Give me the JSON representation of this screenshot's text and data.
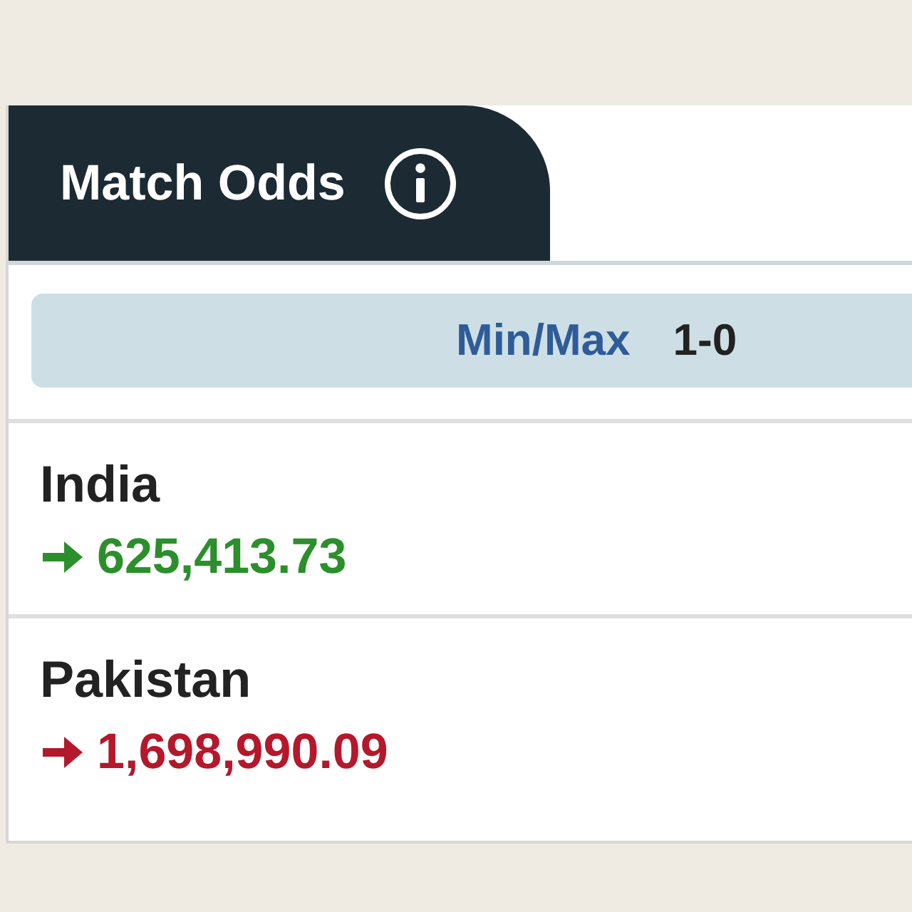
{
  "tab": {
    "title": "Match Odds"
  },
  "limits": {
    "label": "Min/Max",
    "value": "1-0"
  },
  "runners": [
    {
      "name": "India",
      "amount": "625,413.73",
      "kind": "gain"
    },
    {
      "name": "Pakistan",
      "amount": "1,698,990.09",
      "kind": "loss"
    }
  ]
}
